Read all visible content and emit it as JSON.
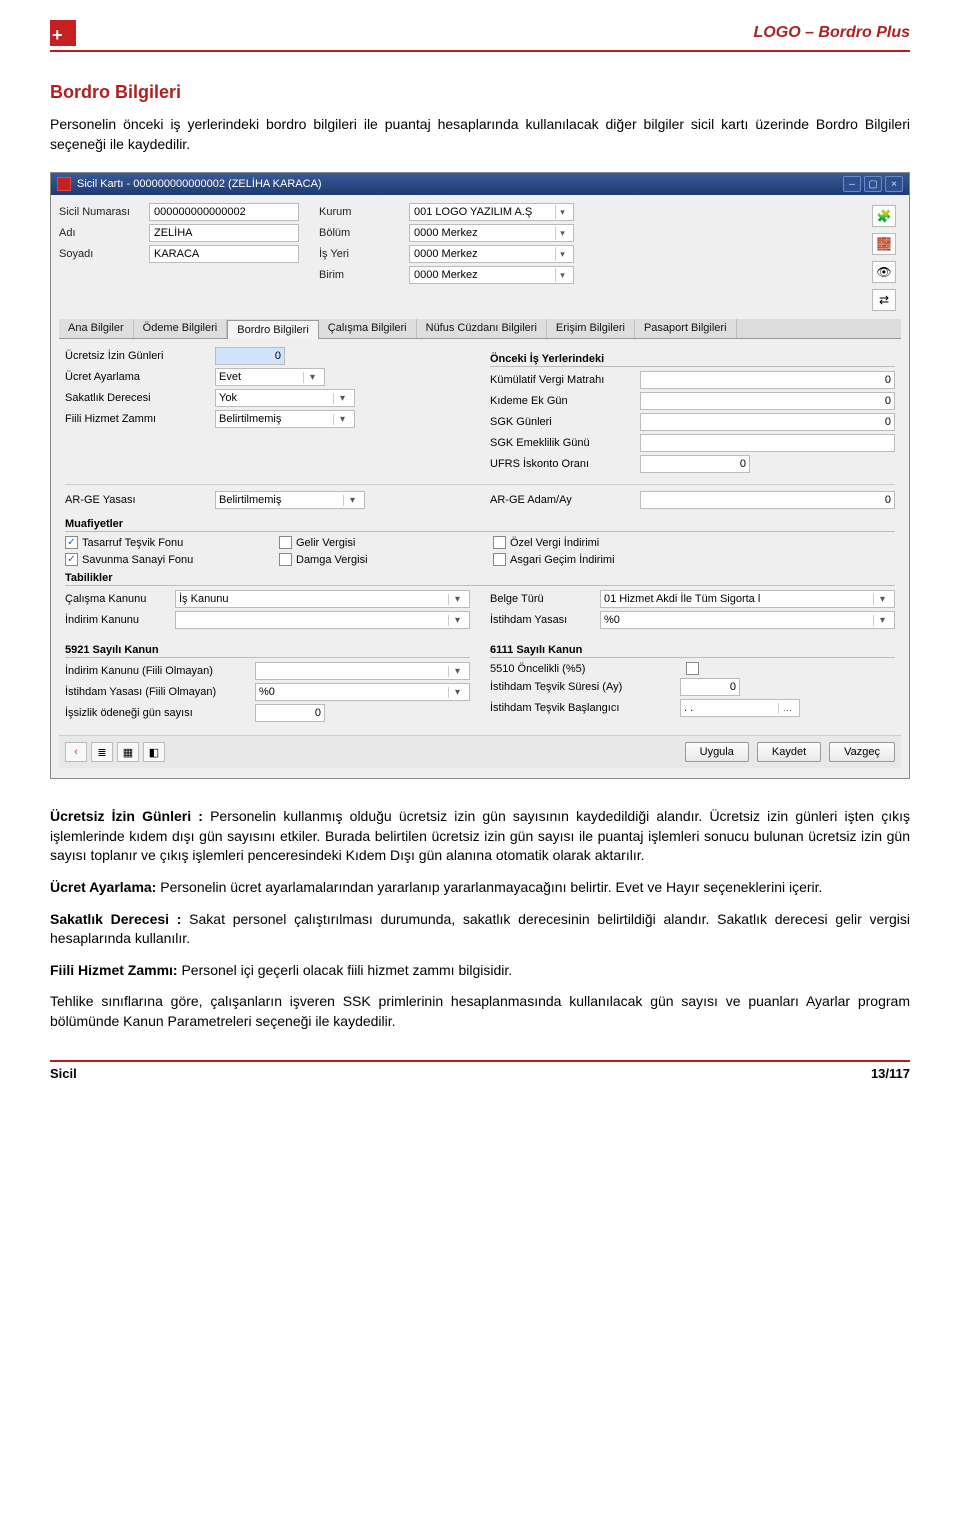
{
  "header": {
    "logo_glyph": "+",
    "brand": "LOGO – Bordro Plus"
  },
  "doc": {
    "title": "Bordro Bilgileri",
    "intro": "Personelin önceki iş yerlerindeki bordro bilgileri ile puantaj hesaplarında kullanılacak diğer bilgiler sicil kartı üzerinde Bordro Bilgileri seçeneği ile kaydedilir.",
    "p1_lead": "Ücretsiz İzin Günleri :",
    "p1_rest": " Personelin kullanmış olduğu ücretsiz izin gün sayısının kaydedildiği alandır. Ücretsiz izin günleri işten çıkış işlemlerinde kıdem dışı gün sayısını etkiler. Burada belirtilen ücretsiz izin gün sayısı ile puantaj işlemleri sonucu bulunan ücretsiz izin gün sayısı toplanır ve çıkış işlemleri penceresindeki Kıdem Dışı gün alanına otomatik olarak aktarılır.",
    "p2_lead": "Ücret Ayarlama:",
    "p2_rest": " Personelin ücret ayarlamalarından yararlanıp yararlanmayacağını belirtir. Evet ve Hayır seçeneklerini içerir.",
    "p3_lead": "Sakatlık Derecesi :",
    "p3_rest": " Sakat personel çalıştırılması durumunda, sakatlık derecesinin belirtildiği alandır. Sakatlık derecesi gelir vergisi hesaplarında kullanılır.",
    "p4_lead": "Fiili Hizmet Zammı:",
    "p4_rest": " Personel içi geçerli olacak fiili hizmet zammı bilgisidir.",
    "p5": "Tehlike sınıflarına göre, çalışanların işveren SSK primlerinin hesaplanmasında kullanılacak gün sayısı ve puanları Ayarlar program bölümünde Kanun Parametreleri seçeneği ile kaydedilir."
  },
  "window": {
    "title": "Sicil Kartı - 000000000000002 (ZELİHA KARACA)",
    "head_labels": {
      "sicil_no": "Sicil Numarası",
      "adi": "Adı",
      "soyadi": "Soyadı",
      "kurum": "Kurum",
      "bolum": "Bölüm",
      "isyeri": "İş Yeri",
      "birim": "Birim"
    },
    "head_values": {
      "sicil_no": "000000000000002",
      "adi": "ZELİHA",
      "soyadi": "KARACA",
      "kurum": "001 LOGO YAZILIM A.Ş",
      "bolum": "0000 Merkez",
      "isyeri": "0000 Merkez",
      "birim": "0000 Merkez"
    },
    "tabs": [
      "Ana Bilgiler",
      "Ödeme Bilgileri",
      "Bordro Bilgileri",
      "Çalışma Bilgileri",
      "Nüfus Cüzdanı Bilgileri",
      "Erişim Bilgileri",
      "Pasaport Bilgileri"
    ],
    "active_tab": 2,
    "left_fields": {
      "uig": {
        "label": "Ücretsiz İzin Günleri",
        "value": "0"
      },
      "ua": {
        "label": "Ücret Ayarlama",
        "value": "Evet"
      },
      "sd": {
        "label": "Sakatlık Derecesi",
        "value": "Yok"
      },
      "fhz": {
        "label": "Fiili Hizmet Zammı",
        "value": "Belirtilmemiş"
      }
    },
    "onceki_grp": "Önceki İş Yerlerindeki",
    "right_fields": {
      "kvm": {
        "label": "Kümülatif Vergi Matrahı",
        "value": "0"
      },
      "keg": {
        "label": "Kıdeme Ek Gün",
        "value": "0"
      },
      "sgk": {
        "label": "SGK Günleri",
        "value": "0"
      },
      "sgke": {
        "label": "SGK Emeklilik Günü",
        "value": ""
      },
      "ufrs": {
        "label": "UFRS İskonto Oranı",
        "value": "0"
      }
    },
    "arge": {
      "yasasi_lbl": "AR-GE Yasası",
      "yasasi_val": "Belirtilmemiş",
      "adam_lbl": "AR-GE Adam/Ay",
      "adam_val": "0"
    },
    "muaf_grp": "Muafiyetler",
    "muaf": {
      "ttf": {
        "label": "Tasarruf Teşvik Fonu",
        "checked": true
      },
      "ssf": {
        "label": "Savunma Sanayi Fonu",
        "checked": true
      },
      "gv": {
        "label": "Gelir Vergisi",
        "checked": false
      },
      "dv": {
        "label": "Damga Vergisi",
        "checked": false
      },
      "ovi": {
        "label": "Özel Vergi İndirimi",
        "checked": false
      },
      "agi": {
        "label": "Asgari Geçim İndirimi",
        "checked": false
      }
    },
    "tab_grp": "Tabilikler",
    "tabilik": {
      "ck": {
        "label": "Çalışma Kanunu",
        "value": "İş Kanunu"
      },
      "ik": {
        "label": "İndirim Kanunu",
        "value": ""
      },
      "bt": {
        "label": "Belge Türü",
        "value": "01 Hizmet Akdi İle Tüm Sigorta l"
      },
      "iy": {
        "label": "İstihdam Yasası",
        "value": "%0"
      }
    },
    "g5921": "5921 Sayılı Kanun",
    "g6111": "6111 Sayılı Kanun",
    "k5921": {
      "ikfo": {
        "label": "İndirim Kanunu (Fiili Olmayan)",
        "value": ""
      },
      "iyfo": {
        "label": "İstihdam Yasası (Fiili Olmayan)",
        "value": "%0"
      },
      "iogs": {
        "label": "İşsizlik ödeneği gün sayısı",
        "value": "0"
      }
    },
    "k6111": {
      "s5510": {
        "label": "5510 Öncelikli (%5)",
        "checked": false
      },
      "its": {
        "label": "İstihdam Teşvik Süresi (Ay)",
        "value": "0"
      },
      "itb": {
        "label": "İstihdam Teşvik Başlangıcı",
        "value": ". ."
      }
    },
    "buttons": {
      "uygula": "Uygula",
      "kaydet": "Kaydet",
      "vazgec": "Vazgeç"
    }
  },
  "footer": {
    "left": "Sicil",
    "right": "13/117"
  }
}
